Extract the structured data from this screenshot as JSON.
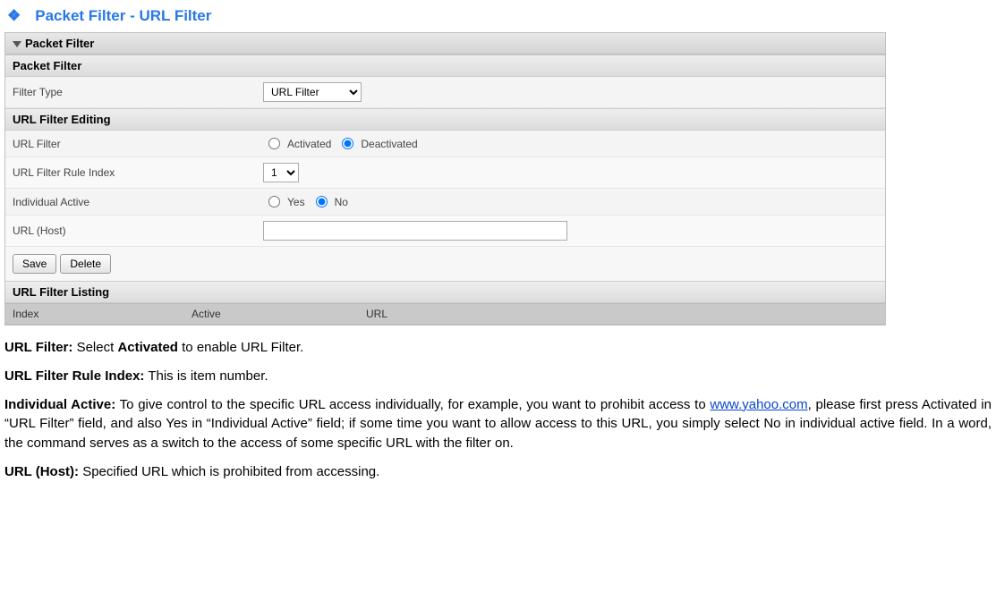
{
  "page": {
    "title": "Packet Filter - URL Filter"
  },
  "panel": {
    "header": "Packet Filter",
    "section1": "Packet Filter",
    "section2": "URL Filter Editing",
    "section3": "URL Filter Listing",
    "filterTypeLabel": "Filter Type",
    "filterTypeValue": "URL Filter",
    "urlFilterLabel": "URL Filter",
    "activatedLabel": "Activated",
    "deactivatedLabel": "Deactivated",
    "ruleIndexLabel": "URL Filter Rule Index",
    "ruleIndexValue": "1",
    "individualActiveLabel": "Individual Active",
    "yesLabel": "Yes",
    "noLabel": "No",
    "urlHostLabel": "URL (Host)",
    "urlHostValue": "",
    "saveLabel": "Save",
    "deleteLabel": "Delete",
    "listing": {
      "indexCol": "Index",
      "activeCol": "Active",
      "urlCol": "URL"
    }
  },
  "desc": {
    "urlFilterBold": "URL Filter:",
    "urlFilterText1": " Select ",
    "urlFilterText2": "Activated",
    "urlFilterText3": " to enable URL Filter.",
    "ruleIndexBold": "URL Filter Rule Index:",
    "ruleIndexText": " This is item number.",
    "individualBold": "Individual Active:",
    "individualText1": " To give control to the specific URL access individually, for example, you want to prohibit access to ",
    "individualLink": "www.yahoo.com",
    "individualText2": ", please first press Activated in “URL Filter” field, and also Yes in “Individual Active” field; if some time you want to allow access to this URL, you simply select No in individual active field. In a word, the command serves as a switch to the access of some specific URL with the filter on.",
    "urlHostBold": "URL (Host):",
    "urlHostText": " Specified URL which is prohibited from accessing."
  }
}
